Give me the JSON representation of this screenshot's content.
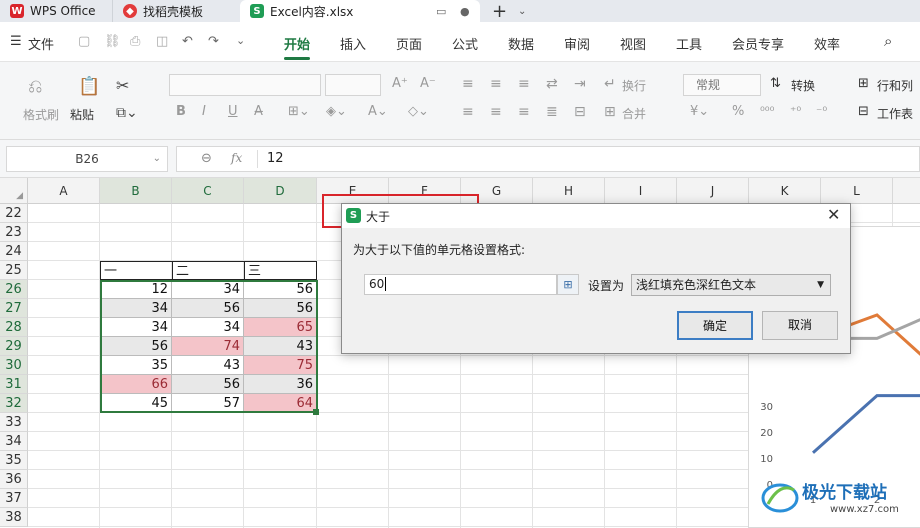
{
  "tabs": [
    {
      "label": "WPS Office",
      "icon": "wps-logo-icon"
    },
    {
      "label": "找稻壳模板",
      "icon": "docer-icon"
    },
    {
      "label": "Excel内容.xlsx",
      "icon": "sheet-icon"
    }
  ],
  "menu": {
    "file": "文件",
    "items": [
      "开始",
      "插入",
      "页面",
      "公式",
      "数据",
      "审阅",
      "视图",
      "工具",
      "会员专享",
      "效率"
    ],
    "active": "开始"
  },
  "ribbon": {
    "format_painter": "格式刷",
    "paste": "粘贴",
    "wrap": "换行",
    "merge": "合并",
    "number_format": "常规",
    "convert": "转换",
    "rows_cols": "行和列",
    "worksheet": "工作表",
    "font_size_placeholder": ""
  },
  "formula_bar": {
    "name_box": "B26",
    "fx": "fx",
    "value": "12"
  },
  "columns": [
    "A",
    "B",
    "C",
    "D",
    "E",
    "F",
    "G",
    "H",
    "I",
    "J",
    "K",
    "L"
  ],
  "rows": [
    "22",
    "23",
    "24",
    "25",
    "26",
    "27",
    "28",
    "29",
    "30",
    "31",
    "32",
    "33",
    "34",
    "35",
    "36",
    "37",
    "38"
  ],
  "table": {
    "headers": [
      "一",
      "二",
      "三"
    ],
    "cells": [
      [
        "12",
        "34",
        "56"
      ],
      [
        "34",
        "56",
        "56"
      ],
      [
        "34",
        "34",
        "65"
      ],
      [
        "56",
        "74",
        "43"
      ],
      [
        "35",
        "43",
        "75"
      ],
      [
        "66",
        "56",
        "36"
      ],
      [
        "45",
        "57",
        "64"
      ]
    ]
  },
  "chart_data": {
    "type": "line",
    "x": [
      "1",
      "2"
    ],
    "y_ticks": [
      "30",
      "20",
      "10",
      "0"
    ],
    "series": [
      {
        "color": "#4a72b0",
        "values": [
          12,
          34
        ]
      },
      {
        "color": "#e07b39",
        "values": [
          56,
          65
        ]
      },
      {
        "color": "#a5a5a5",
        "values": [
          56,
          56
        ]
      }
    ]
  },
  "dialog": {
    "title": "大于",
    "prompt": "为大于以下值的单元格设置格式:",
    "input_value": "60",
    "set_as_label": "设置为",
    "format_option": "浅红填充色深红色文本",
    "ok": "确定",
    "cancel": "取消"
  },
  "watermark": {
    "text": "极光下载站",
    "url": "www.xz7.com"
  }
}
